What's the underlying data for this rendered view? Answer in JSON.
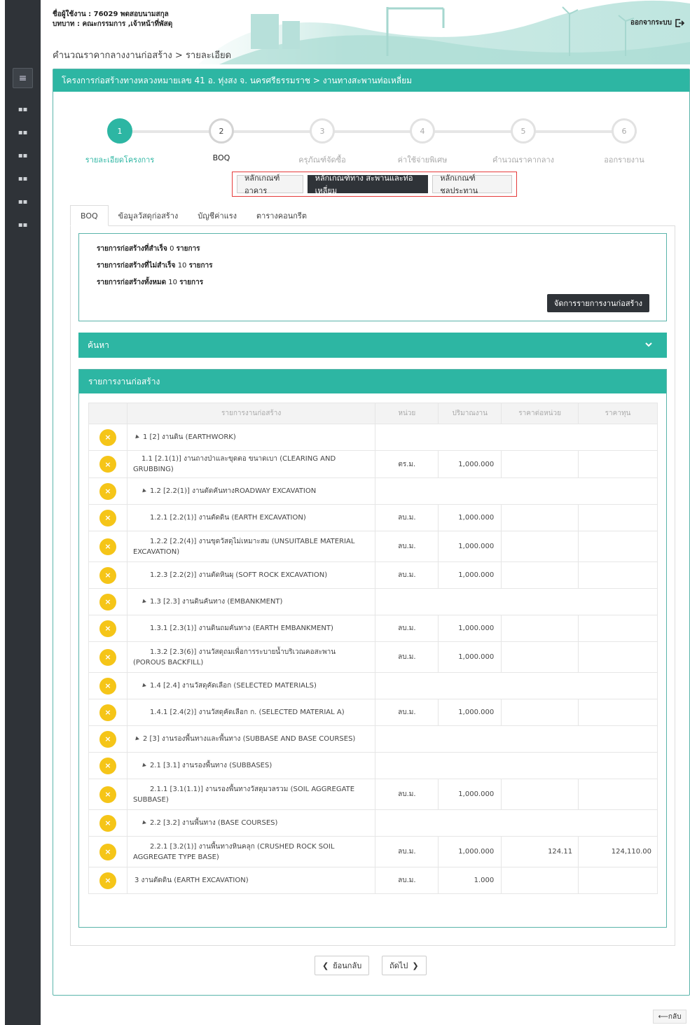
{
  "header": {
    "user_line": "ชื่อผู้ใช้งาน : 76029 พดสอบนามสกุล",
    "role_line": "บทบาท : คณะกรรมการ ,เจ้าหน้าที่พัสดุ",
    "logout_label": "ออกจากระบบ",
    "breadcrumb": "คำนวณราคากลางงานก่อสร้าง > รายละเอียด"
  },
  "main": {
    "title": "โครงการก่อสร้างทางหลวงหมายเลข 41 อ. ทุ่งสง จ. นครศรีธรรมราช > งานทางสะพานท่อเหลี่ยม"
  },
  "steps": [
    {
      "num": "1",
      "label": "รายละเอียดโครงการ",
      "state": "active"
    },
    {
      "num": "2",
      "label": "BOQ",
      "state": "current"
    },
    {
      "num": "3",
      "label": "ครุภัณฑ์จัดซื้อ",
      "state": "pending"
    },
    {
      "num": "4",
      "label": "ค่าใช้จ่ายพิเศษ",
      "state": "pending"
    },
    {
      "num": "5",
      "label": "คำนวณราคากลาง",
      "state": "pending"
    },
    {
      "num": "6",
      "label": "ออกรายงาน",
      "state": "pending"
    }
  ],
  "criteria": {
    "building": "หลักเกณฑ์อาคาร",
    "road": "หลักเกณฑ์ทาง สะพานและท่อเหลี่ยม",
    "irrigation": "หลักเกณฑ์ชลประทาน"
  },
  "tabs": [
    "BOQ",
    "ข้อมูลวัสดุก่อสร้าง",
    "บัญชีค่าแรง",
    "ตารางคอนกรีต"
  ],
  "summary": {
    "done_label": "รายการก่อสร้างที่สำเร็จ",
    "done_count": "0",
    "undone_label": "รายการก่อสร้างที่ไม่สำเร็จ",
    "undone_count": "10",
    "total_label": "รายการก่อสร้างทั้งหมด",
    "total_count": "10",
    "unit_word": "รายการ",
    "manage_button": "จัดการรายการงานก่อสร้าง"
  },
  "search": {
    "title": "ค้นหา"
  },
  "list": {
    "title": "รายการงานก่อสร้าง",
    "columns": [
      "",
      "รายการงานก่อสร้าง",
      "หน่วย",
      "ปริมาณงาน",
      "ราคาต่อหน่วย",
      "ราคาทุน"
    ],
    "rows": [
      {
        "desc": "1 [2] งานดิน (EARTHWORK)",
        "level": 0,
        "group": true,
        "unit": "",
        "qty": "",
        "price": "",
        "cost": ""
      },
      {
        "desc": "1.1 [2.1(1)] งานถางป่าและขุดตอ ขนาดเบา (CLEARING AND GRUBBING)",
        "level": 1,
        "group": false,
        "unit": "ตร.ม.",
        "qty": "1,000.000",
        "price": "",
        "cost": ""
      },
      {
        "desc": "1.2 [2.2(1)] งานตัดคันทางROADWAY EXCAVATION",
        "level": 1,
        "group": true,
        "unit": "",
        "qty": "",
        "price": "",
        "cost": ""
      },
      {
        "desc": "1.2.1 [2.2(1)] งานตัดดิน (EARTH EXCAVATION)",
        "level": 2,
        "group": false,
        "unit": "ลบ.ม.",
        "qty": "1,000.000",
        "price": "",
        "cost": ""
      },
      {
        "desc": "1.2.2 [2.2(4)] งานขุดวัสดุไม่เหมาะสม (UNSUITABLE MATERIAL EXCAVATION)",
        "level": 2,
        "group": false,
        "unit": "ลบ.ม.",
        "qty": "1,000.000",
        "price": "",
        "cost": ""
      },
      {
        "desc": "1.2.3 [2.2(2)] งานตัดหินผุ (SOFT ROCK EXCAVATION)",
        "level": 2,
        "group": false,
        "unit": "ลบ.ม.",
        "qty": "1,000.000",
        "price": "",
        "cost": ""
      },
      {
        "desc": "1.3 [2.3] งานดินคันทาง (EMBANKMENT)",
        "level": 1,
        "group": true,
        "unit": "",
        "qty": "",
        "price": "",
        "cost": ""
      },
      {
        "desc": "1.3.1 [2.3(1)] งานดินถมคันทาง (EARTH EMBANKMENT)",
        "level": 2,
        "group": false,
        "unit": "ลบ.ม.",
        "qty": "1,000.000",
        "price": "",
        "cost": ""
      },
      {
        "desc": "1.3.2 [2.3(6)] งานวัสดุถมเพื่อการระบายน้ำบริเวณคอสะพาน (POROUS BACKFILL)",
        "level": 2,
        "group": false,
        "unit": "ลบ.ม.",
        "qty": "1,000.000",
        "price": "",
        "cost": ""
      },
      {
        "desc": "1.4 [2.4] งานวัสดุคัดเลือก (SELECTED MATERIALS)",
        "level": 1,
        "group": true,
        "unit": "",
        "qty": "",
        "price": "",
        "cost": ""
      },
      {
        "desc": "1.4.1 [2.4(2)] งานวัสดุคัดเลือก ก. (SELECTED MATERIAL A)",
        "level": 2,
        "group": false,
        "unit": "ลบ.ม.",
        "qty": "1,000.000",
        "price": "",
        "cost": ""
      },
      {
        "desc": "2 [3] งานรองพื้นทางและพื้นทาง (SUBBASE AND BASE COURSES)",
        "level": 0,
        "group": true,
        "unit": "",
        "qty": "",
        "price": "",
        "cost": ""
      },
      {
        "desc": "2.1 [3.1] งานรองพื้นทาง (SUBBASES)",
        "level": 1,
        "group": true,
        "unit": "",
        "qty": "",
        "price": "",
        "cost": ""
      },
      {
        "desc": "2.1.1 [3.1(1.1)] งานรองพื้นทางวัสดุมวลรวม (SOIL AGGREGATE SUBBASE)",
        "level": 2,
        "group": false,
        "unit": "ลบ.ม.",
        "qty": "1,000.000",
        "price": "",
        "cost": ""
      },
      {
        "desc": "2.2 [3.2] งานพื้นทาง (BASE COURSES)",
        "level": 1,
        "group": true,
        "unit": "",
        "qty": "",
        "price": "",
        "cost": ""
      },
      {
        "desc": "2.2.1 [3.2(1)] งานพื้นทางหินคลุก (CRUSHED ROCK SOIL AGGREGATE TYPE BASE)",
        "level": 2,
        "group": false,
        "unit": "ลบ.ม.",
        "qty": "1,000.000",
        "price": "124.11",
        "cost": "124,110.00"
      },
      {
        "desc": "3 งานตัดดิน (EARTH EXCAVATION)",
        "level": 0,
        "group": false,
        "unit": "ลบ.ม.",
        "qty": "1.000",
        "price": "",
        "cost": ""
      }
    ]
  },
  "nav": {
    "prev": "ย้อนกลับ",
    "next": "ถัดไป",
    "back": "กลับ"
  },
  "colors": {
    "teal": "#2db6a3",
    "dark": "#2f3338",
    "warning": "#f5c518",
    "highlight_border": "#e53b3b"
  },
  "icons": [
    "menu-icon",
    "grid-icon",
    "logout-icon",
    "chevron-down-icon",
    "close-icon",
    "chevron-left-icon",
    "chevron-right-icon",
    "arrow-left-icon"
  ]
}
